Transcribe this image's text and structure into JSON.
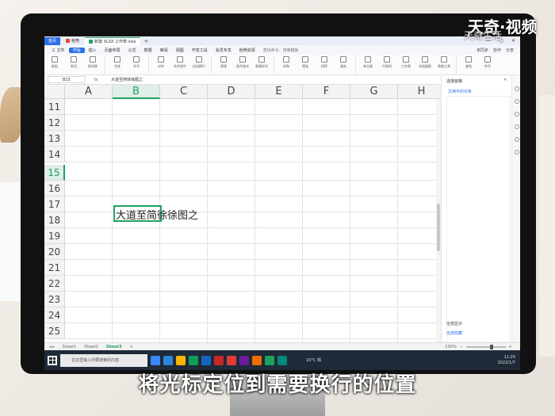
{
  "watermark": {
    "brand": "天奇·视频",
    "sub": "天奇生活"
  },
  "caption": "将光标定位到需要换行的位置",
  "tabbar": {
    "home": "首页",
    "tab1": "稻壳",
    "tab2": "新建 XLSX 工作表.xlsx",
    "plus": "+"
  },
  "menubar": {
    "items": [
      "三 文件",
      "开始",
      "插入",
      "页面布局",
      "公式",
      "数据",
      "审阅",
      "视图",
      "开发工具",
      "会员专享",
      "稻壳资源"
    ],
    "active_index": 1,
    "search": "查找命令、搜索模板",
    "right": [
      "未同步",
      "协作",
      "分享"
    ]
  },
  "ribbon": {
    "groups": [
      "粘贴",
      "剪切",
      "格式刷",
      "字体",
      "字号",
      "对齐",
      "合并居中",
      "自动换行",
      "常规",
      "条件格式",
      "表格样式",
      "求和",
      "筛选",
      "排序",
      "填充",
      "单元格",
      "行和列",
      "工作表",
      "冻结窗格",
      "表格工具",
      "查找",
      "符号"
    ]
  },
  "formula_bar": {
    "name_box": "B15",
    "fx": "fx",
    "content": "大道至简徐徐图之"
  },
  "grid": {
    "columns": [
      "A",
      "B",
      "C",
      "D",
      "E",
      "F",
      "G",
      "H"
    ],
    "rows": [
      "11",
      "12",
      "13",
      "14",
      "15",
      "16",
      "17",
      "18",
      "19",
      "20",
      "21",
      "22",
      "23",
      "24",
      "25"
    ],
    "selected_column": "B",
    "selected_row": "15",
    "cell_text": "大道至简徐徐图之"
  },
  "side_panel": {
    "title": "选择窗格",
    "subtitle": "文档中的对象",
    "footer1": "全部显示",
    "footer2": "全部隐藏"
  },
  "sheets": {
    "tabs": [
      "Sheet1",
      "Sheet2",
      "Sheet3"
    ],
    "active": "Sheet3",
    "zoom": "100%"
  },
  "taskbar": {
    "search": "在这里输入你要搜索的内容",
    "weather": "16°C 晴",
    "time": "11:29",
    "date": "2022/1/7"
  },
  "colors": {
    "accent_green": "#20a162",
    "wps_blue": "#2d6fe8",
    "taskbar": "#1f2a38"
  }
}
